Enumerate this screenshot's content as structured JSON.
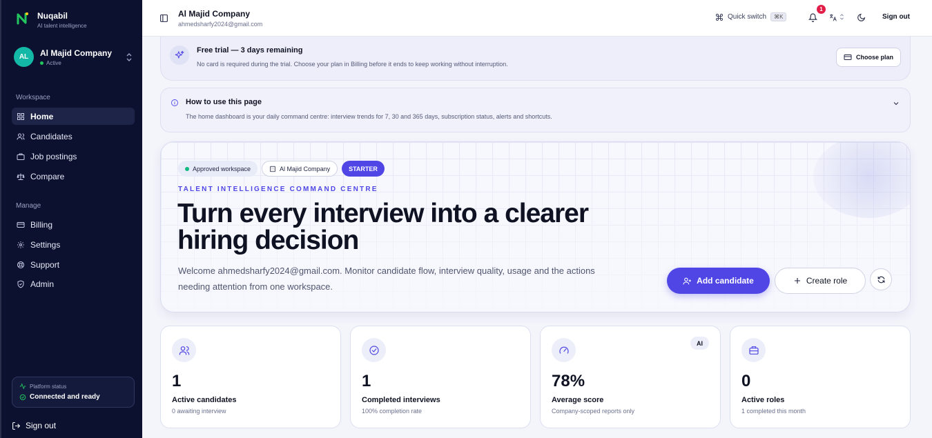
{
  "brand": {
    "name": "Nuqabil",
    "tagline": "AI talent intelligence"
  },
  "workspace": {
    "initials": "AL",
    "name": "Al Majid Company",
    "status": "Active"
  },
  "sidebar": {
    "workspace_label": "Workspace",
    "workspace_items": [
      {
        "label": "Home",
        "icon": "home-icon",
        "active": true
      },
      {
        "label": "Candidates",
        "icon": "users-icon"
      },
      {
        "label": "Job postings",
        "icon": "briefcase-icon"
      },
      {
        "label": "Compare",
        "icon": "scale-icon"
      }
    ],
    "manage_label": "Manage",
    "manage_items": [
      {
        "label": "Billing",
        "icon": "credit-card-icon"
      },
      {
        "label": "Settings",
        "icon": "gear-icon"
      },
      {
        "label": "Support",
        "icon": "lifebuoy-icon"
      },
      {
        "label": "Admin",
        "icon": "shield-icon"
      }
    ],
    "platform_status_label": "Platform status",
    "platform_status_text": "Connected and ready",
    "signout": "Sign out"
  },
  "topbar": {
    "company": "Al Majid Company",
    "email": "ahmedsharfy2024@gmail.com",
    "quick_switch": "Quick switch",
    "quick_switch_kbd": "⌘K",
    "notification_count": "1",
    "signout": "Sign out"
  },
  "trial": {
    "title": "Free trial — 3 days remaining",
    "text": "No card is required during the trial. Choose your plan in Billing before it ends to keep working without interruption.",
    "button": "Choose plan"
  },
  "howto": {
    "title": "How to use this page",
    "text": "The home dashboard is your daily command centre: interview trends for 7, 30 and 365 days, subscription status, alerts and shortcuts."
  },
  "hero": {
    "pill_approved": "Approved workspace",
    "pill_company": "Al Majid Company",
    "pill_plan": "STARTER",
    "eyebrow": "TALENT INTELLIGENCE COMMAND CENTRE",
    "headline": "Turn every interview into a clearer hiring decision",
    "welcome": "Welcome ahmedsharfy2024@gmail.com. Monitor candidate flow, interview quality, usage and the actions needing attention from one workspace.",
    "add_candidate": "Add candidate",
    "create_role": "Create role"
  },
  "stats": [
    {
      "value": "1",
      "label": "Active candidates",
      "sub": "0 awaiting interview",
      "icon": "users-icon"
    },
    {
      "value": "1",
      "label": "Completed interviews",
      "sub": "100% completion rate",
      "icon": "check-circle-icon"
    },
    {
      "value": "78%",
      "label": "Average score",
      "sub": "Company-scoped reports only",
      "icon": "gauge-icon",
      "badge": "AI"
    },
    {
      "value": "0",
      "label": "Active roles",
      "sub": "1 completed this month",
      "icon": "briefcase-icon"
    }
  ],
  "colors": {
    "sidebar_bg": "#0c1130",
    "accent": "#4f46e5",
    "status_green": "#22c55e",
    "badge_red": "#e11d48"
  }
}
